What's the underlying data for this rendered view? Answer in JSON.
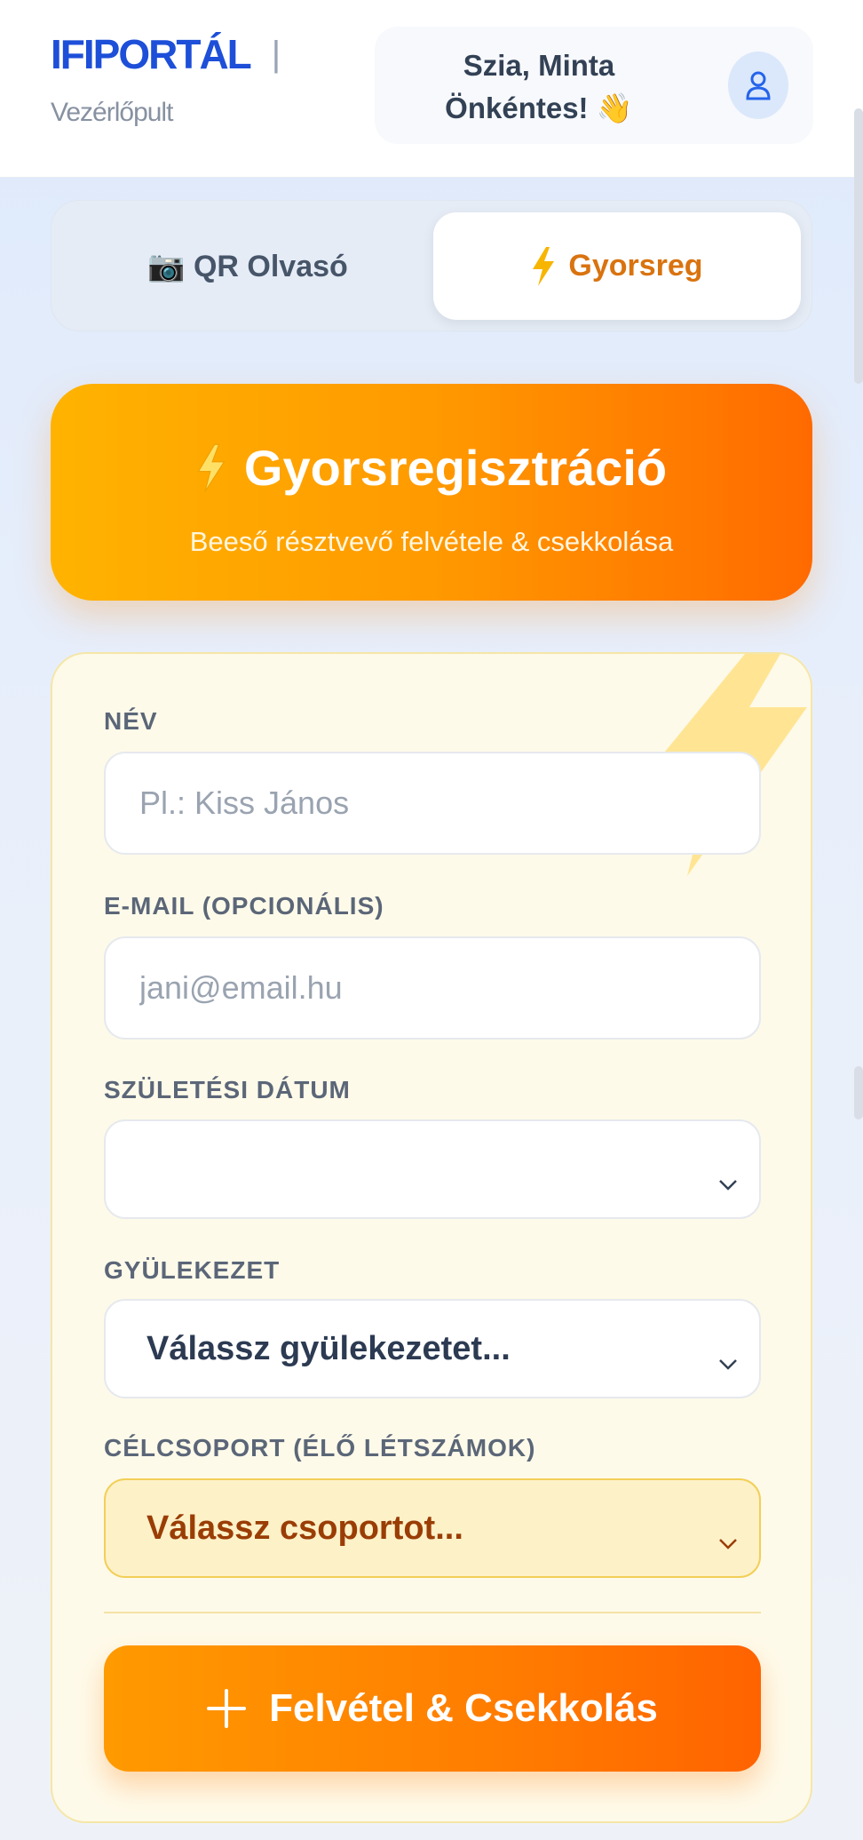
{
  "header": {
    "logo": "IFIPORTÁL",
    "separator": "|",
    "subtitle": "Vezérlőpult",
    "greeting": "Szia, Minta Önkéntes! 👋",
    "avatar_icon": "user-icon"
  },
  "tabs": [
    {
      "label": "📷 QR Olvasó",
      "icon": "camera-icon",
      "active": false
    },
    {
      "label": "Gyorsreg",
      "icon": "lightning-icon",
      "active": true
    }
  ],
  "banner": {
    "title": "Gyorsregisztráció",
    "subtitle": "Beeső résztvevő felvétele & csekkolása",
    "icon": "lightning-icon"
  },
  "form": {
    "name_label": "NÉV",
    "name_placeholder": "Pl.: Kiss János",
    "name_value": "",
    "email_label": "E-MAIL (OPCIONÁLIS)",
    "email_placeholder": "jani@email.hu",
    "email_value": "",
    "birthdate_label": "SZÜLETÉSI DÁTUM",
    "birthdate_value": "",
    "church_label": "GYÜLEKEZET",
    "church_value": "Válassz gyülekezetet...",
    "group_label": "CÉLCSOPORT (ÉLŐ LÉTSZÁMOK)",
    "group_value": "Válassz csoportot...",
    "submit_label": "Felvétel & Csekkolás",
    "submit_icon": "plus-icon"
  },
  "colors": {
    "brand": "#1d4fd8",
    "accent": "#ff8a00",
    "accent_text": "#d9730f"
  }
}
